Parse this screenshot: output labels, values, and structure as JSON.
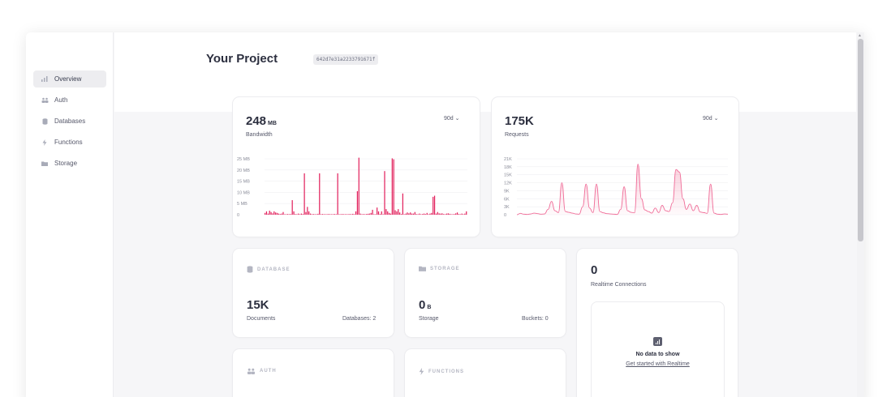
{
  "sidebar": {
    "items": [
      {
        "label": "Overview",
        "icon": "chart-bars-icon",
        "active": true
      },
      {
        "label": "Auth",
        "icon": "users-icon",
        "active": false
      },
      {
        "label": "Databases",
        "icon": "database-icon",
        "active": false
      },
      {
        "label": "Functions",
        "icon": "lightning-icon",
        "active": false
      },
      {
        "label": "Storage",
        "icon": "folder-icon",
        "active": false
      }
    ]
  },
  "header": {
    "title": "Your Project",
    "project_id": "642d7e31a2233791671f"
  },
  "bandwidth": {
    "value": "248",
    "unit": "MB",
    "label": "Bandwidth",
    "range": "90d"
  },
  "requests": {
    "value": "175K",
    "label": "Requests",
    "range": "90d"
  },
  "database": {
    "heading": "DATABASE",
    "value": "15K",
    "label": "Documents",
    "secondary": "Databases: 2"
  },
  "storage": {
    "heading": "STORAGE",
    "value": "0",
    "unit": "B",
    "label": "Storage",
    "secondary": "Buckets: 0"
  },
  "realtime": {
    "value": "0",
    "label": "Realtime Connections",
    "empty_title": "No data to show",
    "empty_link": "Get started with Realtime"
  },
  "auth": {
    "heading": "AUTH"
  },
  "functions": {
    "heading": "FUNCTIONS"
  },
  "colors": {
    "accent": "#e2205c",
    "accent_light": "#f06b97"
  },
  "chart_data": [
    {
      "type": "bar",
      "title": "",
      "ylabel": "",
      "yticks": [
        "25 MB",
        "20 MB",
        "15 MB",
        "10 MB",
        "5 MB",
        "0"
      ],
      "ylim": [
        0,
        25
      ],
      "values": [
        0.8,
        1.5,
        0.5,
        1.8,
        1.2,
        0.6,
        1.5,
        1.0,
        0.8,
        0.5,
        0.3,
        0.5,
        1.2,
        0.2,
        0.1,
        0.3,
        0.2,
        0.3,
        6.5,
        1.5,
        0.3,
        0.2,
        0.5,
        0.2,
        0.5,
        0.3,
        18.5,
        1.2,
        3.5,
        1.5,
        0.5,
        0.1,
        0.3,
        0.2,
        0.2,
        0.4,
        18.5,
        0.1,
        0.3,
        0.1,
        0.2,
        0.2,
        0.3,
        0.2,
        0.1,
        0.2,
        0.3,
        0.1,
        18.5,
        0.2,
        0.1,
        0.3,
        0.2,
        0.1,
        0.1,
        0.2,
        0.3,
        0.2,
        0.4,
        0.1,
        1.5,
        10.5,
        26.5,
        0.5,
        0.2,
        0.3,
        0.2,
        0.3,
        0.4,
        0.5,
        0.8,
        2.2,
        0.2,
        0.1,
        3.2,
        1.5,
        0.3,
        1.5,
        0.2,
        19.5,
        2.5,
        1.5,
        0.8,
        0.5,
        25.2,
        24.8,
        2.0,
        1.5,
        2.5,
        1.0,
        0.3,
        9.5,
        0.2,
        0.5,
        1.0,
        0.6,
        1.0,
        0.5,
        0.5,
        1.2,
        0.3,
        0.2,
        0.5,
        0.1,
        0.3,
        0.5,
        0.3,
        0.8,
        0.2,
        0.5,
        0.8,
        8.0,
        8.5,
        0.5,
        1.2,
        0.6,
        0.5,
        0.6,
        0.3,
        0.2,
        0.5,
        0.6,
        0.4,
        0.2,
        0.1,
        0.3,
        0.6,
        1.0,
        0.3,
        0.1,
        0.5,
        0.2,
        0.5,
        1.5
      ]
    },
    {
      "type": "area",
      "title": "",
      "ylabel": "",
      "yticks": [
        "21K",
        "18K",
        "15K",
        "12K",
        "9K",
        "6K",
        "3K",
        "0"
      ],
      "ylim": [
        0,
        21000
      ],
      "values": [
        0,
        500,
        200,
        100,
        300,
        600,
        400,
        200,
        300,
        2000,
        5000,
        1500,
        800,
        12000,
        1200,
        900,
        600,
        300,
        200,
        3000,
        11500,
        2500,
        800,
        11500,
        1200,
        700,
        400,
        300,
        200,
        100,
        2000,
        10500,
        1500,
        900,
        700,
        19000,
        6000,
        1800,
        1200,
        600,
        2500,
        800,
        3500,
        1500,
        1200,
        4500,
        17000,
        16000,
        6000,
        2000,
        4000,
        1500,
        3500,
        1000,
        800,
        500,
        11500,
        600,
        200,
        100,
        300,
        200
      ]
    }
  ]
}
